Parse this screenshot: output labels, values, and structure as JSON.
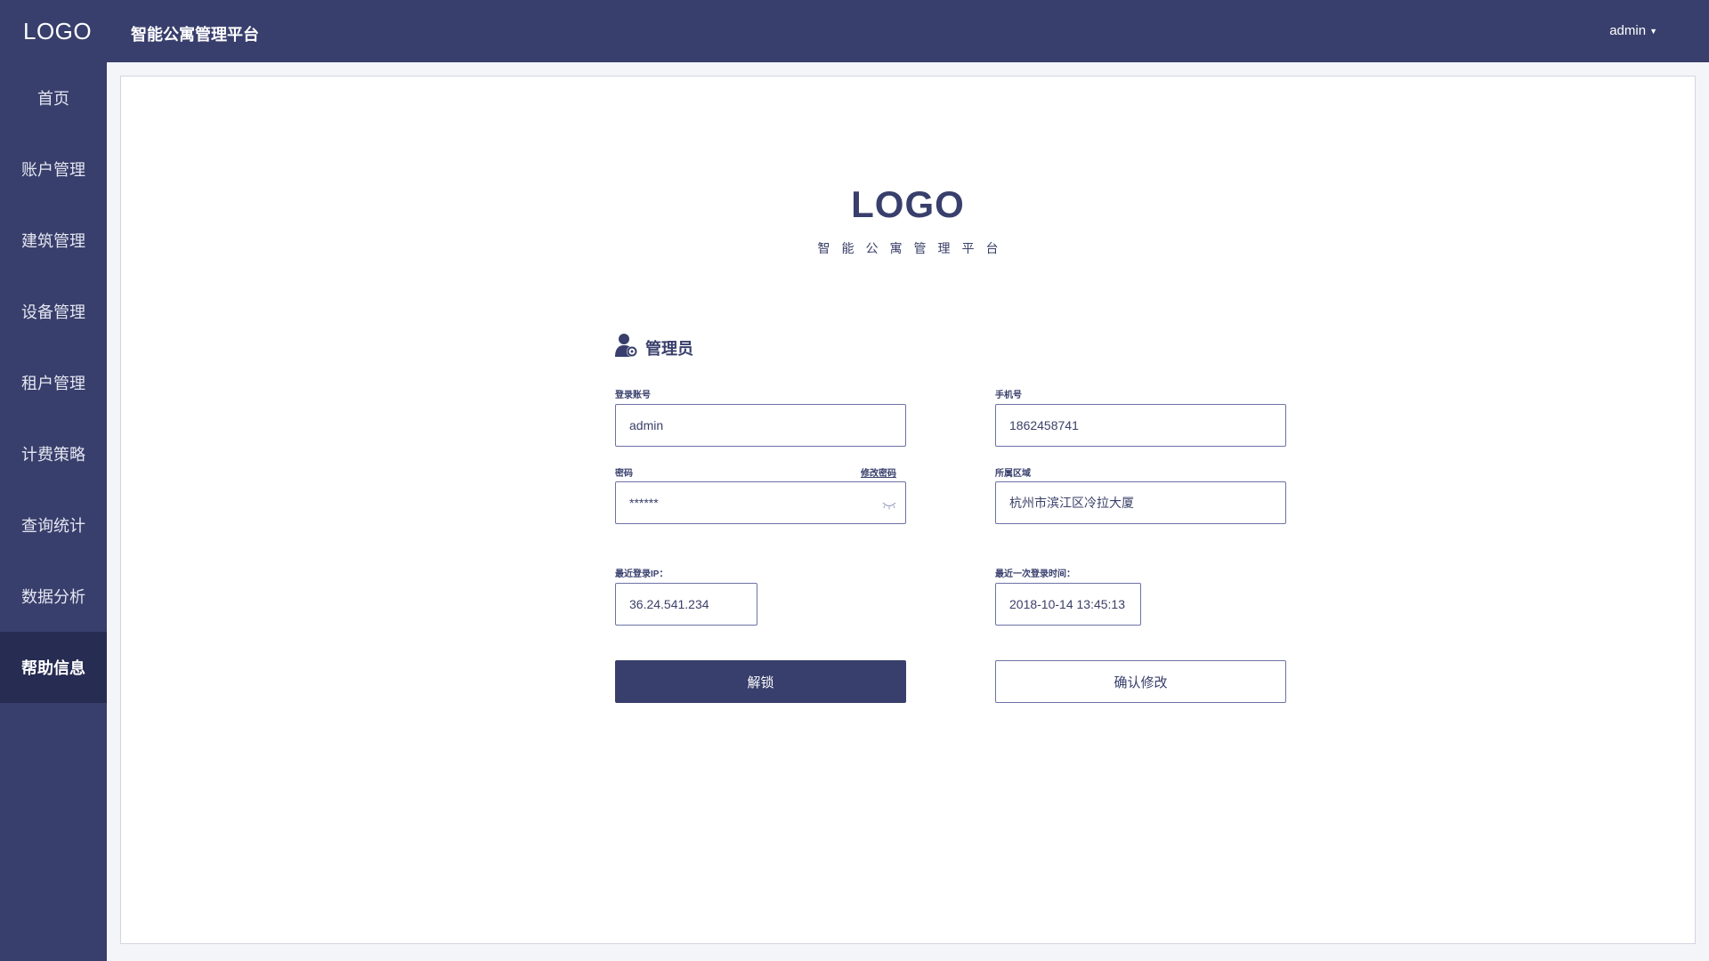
{
  "header": {
    "logo": "LOGO",
    "title": "智能公寓管理平台",
    "user": "admin"
  },
  "sidebar": {
    "items": [
      {
        "label": "首页"
      },
      {
        "label": "账户管理"
      },
      {
        "label": "建筑管理"
      },
      {
        "label": "设备管理"
      },
      {
        "label": "租户管理"
      },
      {
        "label": "计费策略"
      },
      {
        "label": "查询统计"
      },
      {
        "label": "数据分析"
      },
      {
        "label": "帮助信息"
      }
    ],
    "active": "帮助信息"
  },
  "main": {
    "logo": "LOGO",
    "subtitle": "智能公寓管理平台",
    "section_title": "管理员",
    "fields": {
      "account": {
        "label": "登录账号",
        "value": "admin"
      },
      "phone": {
        "label": "手机号",
        "value": "1862458741"
      },
      "password": {
        "label": "密码",
        "value": "******",
        "change_link": "修改密码"
      },
      "region": {
        "label": "所属区域",
        "value": "杭州市滨江区冷拉大厦"
      },
      "last_ip": {
        "label": "最近登录IP：",
        "value": "36.24.541.234"
      },
      "last_time": {
        "label": "最近一次登录时间：",
        "value": "2018-10-14 13:45:13"
      }
    },
    "buttons": {
      "unlock": "解锁",
      "confirm": "确认修改"
    }
  },
  "colors": {
    "primary": "#383f6c",
    "sidebar_active": "#262c52",
    "border": "#6c72a6",
    "background": "#f4f5f8"
  },
  "icons": [
    "admin-user-icon",
    "eye-closed-icon",
    "chevron-down-icon"
  ]
}
